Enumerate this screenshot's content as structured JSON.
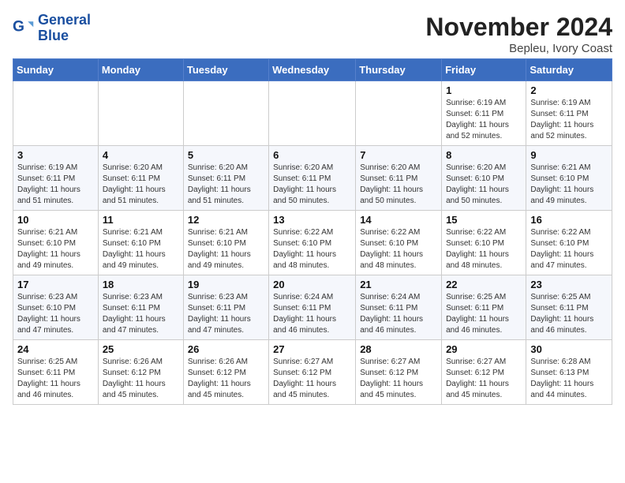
{
  "header": {
    "logo_line1": "General",
    "logo_line2": "Blue",
    "month_title": "November 2024",
    "location": "Bepleu, Ivory Coast"
  },
  "weekdays": [
    "Sunday",
    "Monday",
    "Tuesday",
    "Wednesday",
    "Thursday",
    "Friday",
    "Saturday"
  ],
  "weeks": [
    [
      {
        "day": "",
        "info": ""
      },
      {
        "day": "",
        "info": ""
      },
      {
        "day": "",
        "info": ""
      },
      {
        "day": "",
        "info": ""
      },
      {
        "day": "",
        "info": ""
      },
      {
        "day": "1",
        "info": "Sunrise: 6:19 AM\nSunset: 6:11 PM\nDaylight: 11 hours and 52 minutes."
      },
      {
        "day": "2",
        "info": "Sunrise: 6:19 AM\nSunset: 6:11 PM\nDaylight: 11 hours and 52 minutes."
      }
    ],
    [
      {
        "day": "3",
        "info": "Sunrise: 6:19 AM\nSunset: 6:11 PM\nDaylight: 11 hours and 51 minutes."
      },
      {
        "day": "4",
        "info": "Sunrise: 6:20 AM\nSunset: 6:11 PM\nDaylight: 11 hours and 51 minutes."
      },
      {
        "day": "5",
        "info": "Sunrise: 6:20 AM\nSunset: 6:11 PM\nDaylight: 11 hours and 51 minutes."
      },
      {
        "day": "6",
        "info": "Sunrise: 6:20 AM\nSunset: 6:11 PM\nDaylight: 11 hours and 50 minutes."
      },
      {
        "day": "7",
        "info": "Sunrise: 6:20 AM\nSunset: 6:11 PM\nDaylight: 11 hours and 50 minutes."
      },
      {
        "day": "8",
        "info": "Sunrise: 6:20 AM\nSunset: 6:10 PM\nDaylight: 11 hours and 50 minutes."
      },
      {
        "day": "9",
        "info": "Sunrise: 6:21 AM\nSunset: 6:10 PM\nDaylight: 11 hours and 49 minutes."
      }
    ],
    [
      {
        "day": "10",
        "info": "Sunrise: 6:21 AM\nSunset: 6:10 PM\nDaylight: 11 hours and 49 minutes."
      },
      {
        "day": "11",
        "info": "Sunrise: 6:21 AM\nSunset: 6:10 PM\nDaylight: 11 hours and 49 minutes."
      },
      {
        "day": "12",
        "info": "Sunrise: 6:21 AM\nSunset: 6:10 PM\nDaylight: 11 hours and 49 minutes."
      },
      {
        "day": "13",
        "info": "Sunrise: 6:22 AM\nSunset: 6:10 PM\nDaylight: 11 hours and 48 minutes."
      },
      {
        "day": "14",
        "info": "Sunrise: 6:22 AM\nSunset: 6:10 PM\nDaylight: 11 hours and 48 minutes."
      },
      {
        "day": "15",
        "info": "Sunrise: 6:22 AM\nSunset: 6:10 PM\nDaylight: 11 hours and 48 minutes."
      },
      {
        "day": "16",
        "info": "Sunrise: 6:22 AM\nSunset: 6:10 PM\nDaylight: 11 hours and 47 minutes."
      }
    ],
    [
      {
        "day": "17",
        "info": "Sunrise: 6:23 AM\nSunset: 6:10 PM\nDaylight: 11 hours and 47 minutes."
      },
      {
        "day": "18",
        "info": "Sunrise: 6:23 AM\nSunset: 6:11 PM\nDaylight: 11 hours and 47 minutes."
      },
      {
        "day": "19",
        "info": "Sunrise: 6:23 AM\nSunset: 6:11 PM\nDaylight: 11 hours and 47 minutes."
      },
      {
        "day": "20",
        "info": "Sunrise: 6:24 AM\nSunset: 6:11 PM\nDaylight: 11 hours and 46 minutes."
      },
      {
        "day": "21",
        "info": "Sunrise: 6:24 AM\nSunset: 6:11 PM\nDaylight: 11 hours and 46 minutes."
      },
      {
        "day": "22",
        "info": "Sunrise: 6:25 AM\nSunset: 6:11 PM\nDaylight: 11 hours and 46 minutes."
      },
      {
        "day": "23",
        "info": "Sunrise: 6:25 AM\nSunset: 6:11 PM\nDaylight: 11 hours and 46 minutes."
      }
    ],
    [
      {
        "day": "24",
        "info": "Sunrise: 6:25 AM\nSunset: 6:11 PM\nDaylight: 11 hours and 46 minutes."
      },
      {
        "day": "25",
        "info": "Sunrise: 6:26 AM\nSunset: 6:12 PM\nDaylight: 11 hours and 45 minutes."
      },
      {
        "day": "26",
        "info": "Sunrise: 6:26 AM\nSunset: 6:12 PM\nDaylight: 11 hours and 45 minutes."
      },
      {
        "day": "27",
        "info": "Sunrise: 6:27 AM\nSunset: 6:12 PM\nDaylight: 11 hours and 45 minutes."
      },
      {
        "day": "28",
        "info": "Sunrise: 6:27 AM\nSunset: 6:12 PM\nDaylight: 11 hours and 45 minutes."
      },
      {
        "day": "29",
        "info": "Sunrise: 6:27 AM\nSunset: 6:12 PM\nDaylight: 11 hours and 45 minutes."
      },
      {
        "day": "30",
        "info": "Sunrise: 6:28 AM\nSunset: 6:13 PM\nDaylight: 11 hours and 44 minutes."
      }
    ]
  ]
}
